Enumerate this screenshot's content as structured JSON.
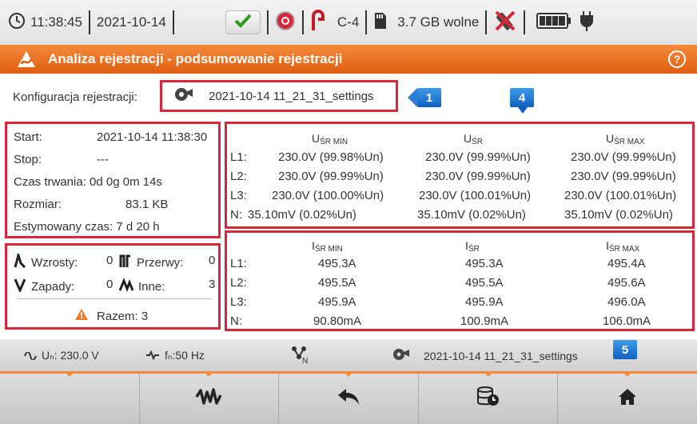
{
  "status": {
    "time": "11:38:45",
    "date": "2021-10-14",
    "clamp": "C-4",
    "storage": "3.7 GB wolne"
  },
  "title": "Analiza rejestracji - podsumowanie rejestracji",
  "help_glyph": "?",
  "config": {
    "label": "Konfiguracja rejestracji:",
    "value": "2021-10-14 11_21_31_settings"
  },
  "badges": [
    "1",
    "4",
    "5"
  ],
  "info": {
    "start_label": "Start:",
    "start_value": "2021-10-14 11:38:30",
    "stop_label": "Stop:",
    "stop_value": "---",
    "duration": "Czas trwania: 0d 0g 0m 14s",
    "size_label": "Rozmiar:",
    "size_value": "83.1 KB",
    "estimated": "Estymowany czas: 7 d 20 h"
  },
  "events": {
    "rises_label": "Wzrosty:",
    "rises": "0",
    "interruptions_label": "Przerwy:",
    "interruptions": "0",
    "dips_label": "Zapady:",
    "dips": "0",
    "other_label": "Inne:",
    "other": "3",
    "total": "Razem: 3"
  },
  "voltage": {
    "headers": [
      {
        "base": "U",
        "sub": "ŚR MIN"
      },
      {
        "base": "U",
        "sub": "ŚR"
      },
      {
        "base": "U",
        "sub": "ŚR MAX"
      }
    ],
    "rows": [
      {
        "label": "L1:",
        "values": [
          "230.0V (99.98%Un)",
          "230.0V (99.99%Un)",
          "230.0V (99.99%Un)"
        ]
      },
      {
        "label": "L2:",
        "values": [
          "230.0V (99.99%Un)",
          "230.0V (99.99%Un)",
          "230.0V (99.99%Un)"
        ]
      },
      {
        "label": "L3:",
        "values": [
          "230.0V (100.00%Un)",
          "230.0V (100.01%Un)",
          "230.0V (100.01%Un)"
        ]
      },
      {
        "label": "N:",
        "values": [
          "35.10mV (0.02%Un)",
          "35.10mV (0.02%Un)",
          "35.10mV (0.02%Un)"
        ]
      }
    ]
  },
  "current": {
    "headers": [
      {
        "base": "I",
        "sub": "ŚR MIN"
      },
      {
        "base": "I",
        "sub": "ŚR"
      },
      {
        "base": "I",
        "sub": "ŚR MAX"
      }
    ],
    "rows": [
      {
        "label": "L1:",
        "values": [
          "495.3A",
          "495.3A",
          "495.4A"
        ]
      },
      {
        "label": "L2:",
        "values": [
          "495.5A",
          "495.5A",
          "495.6A"
        ]
      },
      {
        "label": "L3:",
        "values": [
          "495.9A",
          "495.9A",
          "496.0A"
        ]
      },
      {
        "label": "N:",
        "values": [
          "90.80mA",
          "100.9mA",
          "106.0mA"
        ]
      }
    ]
  },
  "infobar": {
    "un": "Uₙ: 230.0 V",
    "fn": "fₙ:50 Hz",
    "settings": "2021-10-14 11_21_31_settings"
  },
  "colors": {
    "accent": "#f07a28",
    "highlight": "#d6283a",
    "badge": "#1f78d8"
  }
}
